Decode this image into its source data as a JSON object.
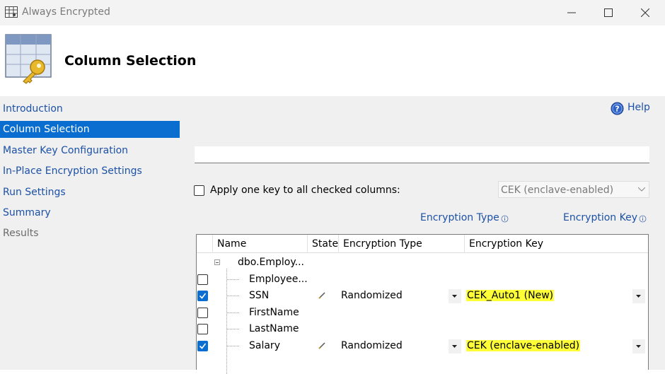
{
  "window": {
    "title": "Always Encrypted"
  },
  "header": {
    "title": "Column Selection"
  },
  "sidebar": {
    "items": [
      {
        "label": "Introduction",
        "state": "link"
      },
      {
        "label": "Column Selection",
        "state": "active"
      },
      {
        "label": "Master Key Configuration",
        "state": "link"
      },
      {
        "label": "In-Place Encryption Settings",
        "state": "link"
      },
      {
        "label": "Run Settings",
        "state": "link"
      },
      {
        "label": "Summary",
        "state": "link"
      },
      {
        "label": "Results",
        "state": "disabled"
      }
    ]
  },
  "main": {
    "help_label": "Help",
    "search_value": "",
    "apply_one_key": {
      "label": "Apply one key to all checked columns:",
      "checked": false
    },
    "key_select": {
      "value": "CEK (enclave-enabled)"
    },
    "encryption_type_link": "Encryption Type",
    "encryption_key_link": "Encryption Key",
    "grid": {
      "columns": [
        "Name",
        "State",
        "Encryption Type",
        "Encryption Key"
      ],
      "table_node": "dbo.Employ...",
      "rows": [
        {
          "name": "Employee...",
          "checked": false,
          "state_icon": "",
          "encryption_type": "",
          "encryption_key": ""
        },
        {
          "name": "SSN",
          "checked": true,
          "state_icon": "pencil-icon",
          "encryption_type": "Randomized",
          "encryption_key": "CEK_Auto1 (New)"
        },
        {
          "name": "FirstName",
          "checked": false,
          "state_icon": "",
          "encryption_type": "",
          "encryption_key": ""
        },
        {
          "name": "LastName",
          "checked": false,
          "state_icon": "",
          "encryption_type": "",
          "encryption_key": ""
        },
        {
          "name": "Salary",
          "checked": true,
          "state_icon": "pencil-icon",
          "encryption_type": "Randomized",
          "encryption_key": "CEK (enclave-enabled)"
        }
      ]
    }
  },
  "colors": {
    "accent": "#0a6ed1",
    "link": "#1c51a6",
    "highlight": "#ffff38",
    "panel": "#f0f0f0"
  }
}
